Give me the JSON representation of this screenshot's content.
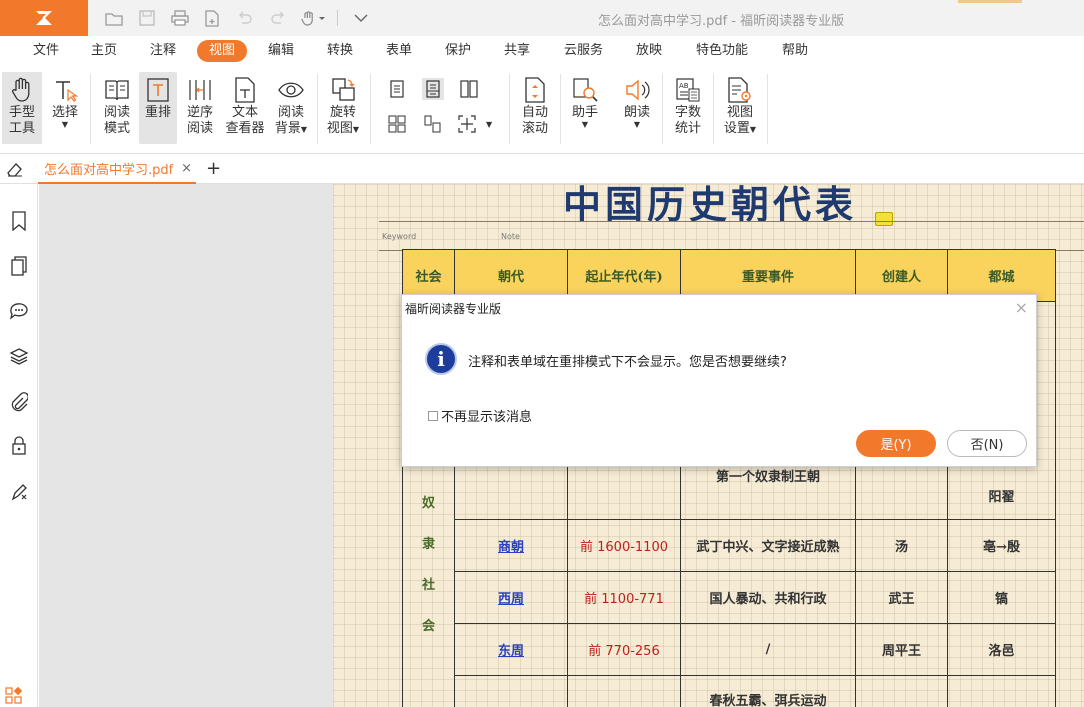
{
  "titlebar": {
    "title": "怎么面对高中学习.pdf - 福昕阅读器专业版",
    "accent": "#f2792b"
  },
  "menu": {
    "items": [
      "文件",
      "主页",
      "注释",
      "视图",
      "编辑",
      "转换",
      "表单",
      "保护",
      "共享",
      "云服务",
      "放映",
      "特色功能",
      "帮助"
    ],
    "active": "视图"
  },
  "ribbon": {
    "hand_tool": [
      "手型",
      "工具"
    ],
    "select": "选择",
    "read_mode": [
      "阅读",
      "模式"
    ],
    "reflow": "重排",
    "reverse_read": [
      "逆序",
      "阅读"
    ],
    "text_viewer": [
      "文本",
      "查看器"
    ],
    "read_bg": [
      "阅读",
      "背景"
    ],
    "rotate_view": [
      "旋转",
      "视图"
    ],
    "auto_scroll": [
      "自动",
      "滚动"
    ],
    "assistant": "助手",
    "read_aloud": "朗读",
    "word_count": [
      "字数",
      "统计"
    ],
    "view_settings": [
      "视图",
      "设置"
    ]
  },
  "tab": {
    "filename": "怎么面对高中学习.pdf",
    "close": "×",
    "add": "+"
  },
  "page": {
    "title": "中国历史朝代表",
    "keyword_label": "Keyword",
    "note_label": "Note",
    "headers": [
      "社会",
      "朝代",
      "起止年代(年)",
      "重要事件",
      "创建人",
      "都城"
    ],
    "first_dynasty_event": "第一个奴隶制王朝",
    "first_capital": "阳翟",
    "society_chars": [
      "奴",
      "隶",
      "社",
      "会"
    ],
    "rows": [
      {
        "dynasty": "商朝",
        "years": "前 1600-1100",
        "event": "武丁中兴、文字接近成熟",
        "founder": "汤",
        "capital": "亳→殷"
      },
      {
        "dynasty": "西周",
        "years": "前 1100-771",
        "event": "国人暴动、共和行政",
        "founder": "武王",
        "capital": "镐"
      },
      {
        "dynasty": "东周",
        "years": "前 770-256",
        "event": "/",
        "founder": "周平王",
        "capital": "洛邑"
      }
    ],
    "last_event": "春秋五霸、弭兵运动"
  },
  "dialog": {
    "title": "福昕阅读器专业版",
    "close": "×",
    "info_glyph": "i",
    "message": "注释和表单域在重排模式下不会显示。您是否想要继续?",
    "checkbox_label": "不再显示该消息",
    "yes": "是(Y)",
    "no": "否(N)"
  }
}
